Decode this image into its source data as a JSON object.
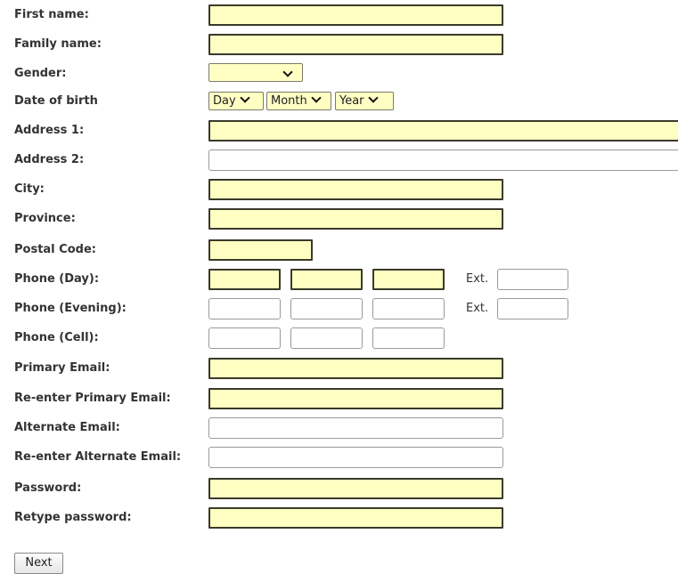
{
  "form": {
    "first_name": {
      "label": "First name:",
      "value": ""
    },
    "family_name": {
      "label": "Family name:",
      "value": ""
    },
    "gender": {
      "label": "Gender:",
      "selected": ""
    },
    "dob": {
      "label": "Date of birth",
      "day": "Day",
      "month": "Month",
      "year": "Year"
    },
    "address1": {
      "label": "Address 1:",
      "value": ""
    },
    "address2": {
      "label": "Address 2:",
      "value": ""
    },
    "city": {
      "label": "City:",
      "value": ""
    },
    "province": {
      "label": "Province:",
      "value": ""
    },
    "postal_code": {
      "label": "Postal Code:",
      "value": ""
    },
    "phone_day": {
      "label": "Phone (Day):",
      "ext_label": "Ext."
    },
    "phone_evening": {
      "label": "Phone (Evening):",
      "ext_label": "Ext."
    },
    "phone_cell": {
      "label": "Phone (Cell):"
    },
    "primary_email": {
      "label": "Primary Email:",
      "value": ""
    },
    "reenter_primary_email": {
      "label": "Re-enter Primary Email:",
      "value": ""
    },
    "alternate_email": {
      "label": "Alternate Email:",
      "value": ""
    },
    "reenter_alternate_email": {
      "label": "Re-enter Alternate Email:",
      "value": ""
    },
    "password": {
      "label": "Password:",
      "value": ""
    },
    "retype_password": {
      "label": "Retype password:",
      "value": ""
    }
  },
  "actions": {
    "next_label": "Next"
  },
  "colors": {
    "required_fill": "#ffffc4",
    "required_border": "#3a3a2a",
    "optional_border": "#9a9a9a"
  }
}
